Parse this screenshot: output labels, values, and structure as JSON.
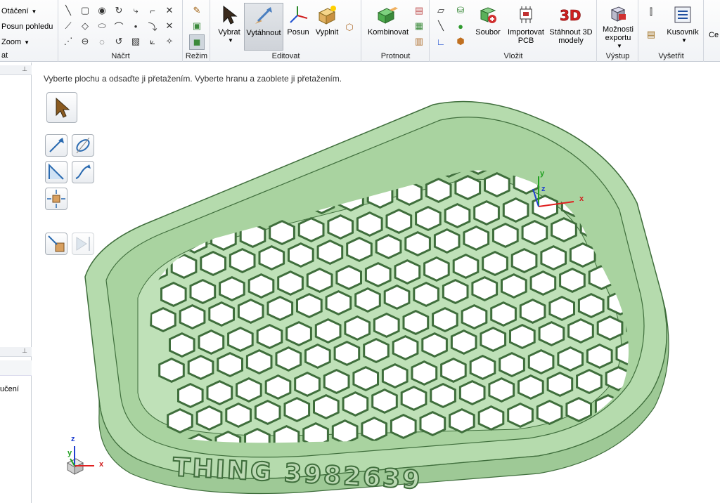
{
  "ribbon": {
    "orient": {
      "items": [
        "Otáčení",
        "Posun pohledu",
        "Zoom"
      ],
      "label_partial": "at"
    },
    "groups": {
      "sketch": "Náčrt",
      "mode": "Režim",
      "edit": "Editovat",
      "intersect": "Protnout",
      "insert": "Vložit",
      "output": "Výstup",
      "inspect": "Vyšetřit"
    },
    "buttons": {
      "select": "Vybrat",
      "pull": "Vytáhnout",
      "move": "Posun",
      "fill": "Vyplnit",
      "combine": "Kombinovat",
      "file": "Soubor",
      "import_pcb": "Importovat PCB",
      "download_3d": "Stáhnout 3D modely",
      "export_options": "Možnosti exportu",
      "bom": "Kusovník",
      "cut_partial": "Ce"
    }
  },
  "panel": {
    "item_partial": "učení"
  },
  "viewport": {
    "hint": "Vyberte plochu a odsaďte ji přetažením. Vyberte hranu a zaoblete ji přetažením.",
    "model_text": "THING 3982639",
    "axes": {
      "x": "x",
      "y": "y",
      "z": "z"
    },
    "model_color": "#a9d3a0",
    "edge_color": "#3f6e3c"
  }
}
